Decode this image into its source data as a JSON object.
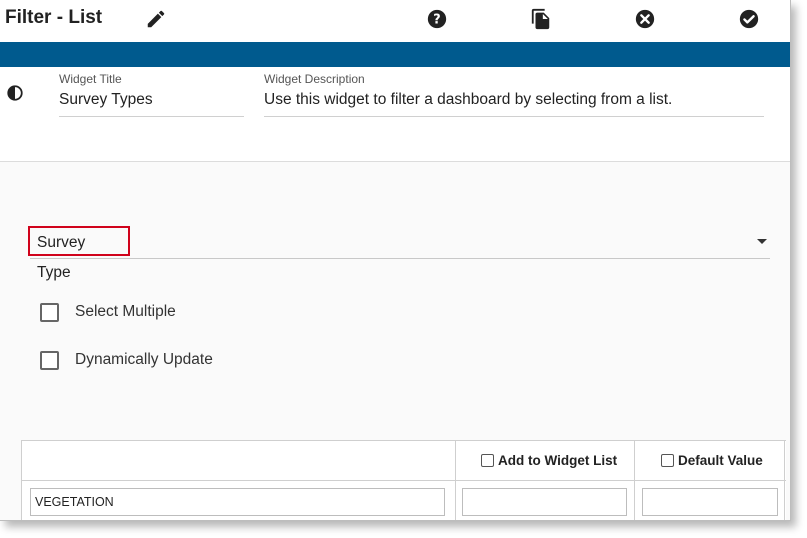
{
  "header": {
    "title": "Filter - List",
    "icons": [
      "pencil-icon",
      "help-icon",
      "copy-icon",
      "close-icon",
      "check-icon"
    ]
  },
  "colors": {
    "accent_bar": "#005a8e",
    "highlight_border": "#d0021b"
  },
  "widget": {
    "title_label": "Widget Title",
    "title_value": "Survey Types",
    "description_label": "Widget Description",
    "description_value": "Use this widget to filter a dashboard by selecting from a list."
  },
  "select": {
    "value": "Survey Type"
  },
  "options": {
    "select_multiple": {
      "label": "Select Multiple",
      "checked": false
    },
    "dynamically_update": {
      "label": "Dynamically Update",
      "checked": false
    }
  },
  "table": {
    "headers": [
      "",
      "Add to Widget List",
      "Default Value"
    ],
    "rows": [
      {
        "name": "VEGETATION",
        "add": "",
        "default": ""
      }
    ]
  }
}
